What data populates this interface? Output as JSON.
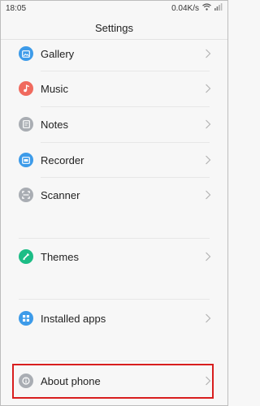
{
  "status_bar": {
    "time": "18:05",
    "speed": "0.04K/s"
  },
  "title": "Settings",
  "items": [
    {
      "label": "Gallery",
      "icon": "gallery-icon",
      "color": "#3d9be9"
    },
    {
      "label": "Music",
      "icon": "music-icon",
      "color": "#f06a5e"
    },
    {
      "label": "Notes",
      "icon": "notes-icon",
      "color": "#a9adb3"
    },
    {
      "label": "Recorder",
      "icon": "recorder-icon",
      "color": "#3d9be9"
    },
    {
      "label": "Scanner",
      "icon": "scanner-icon",
      "color": "#a9adb3"
    },
    {
      "label": "Themes",
      "icon": "themes-icon",
      "color": "#1dbd86"
    },
    {
      "label": "Installed apps",
      "icon": "installed-apps-icon",
      "color": "#3d9be9"
    },
    {
      "label": "About phone",
      "icon": "info-icon",
      "color": "#a9adb3"
    }
  ],
  "highlight_color": "#d81e1e"
}
